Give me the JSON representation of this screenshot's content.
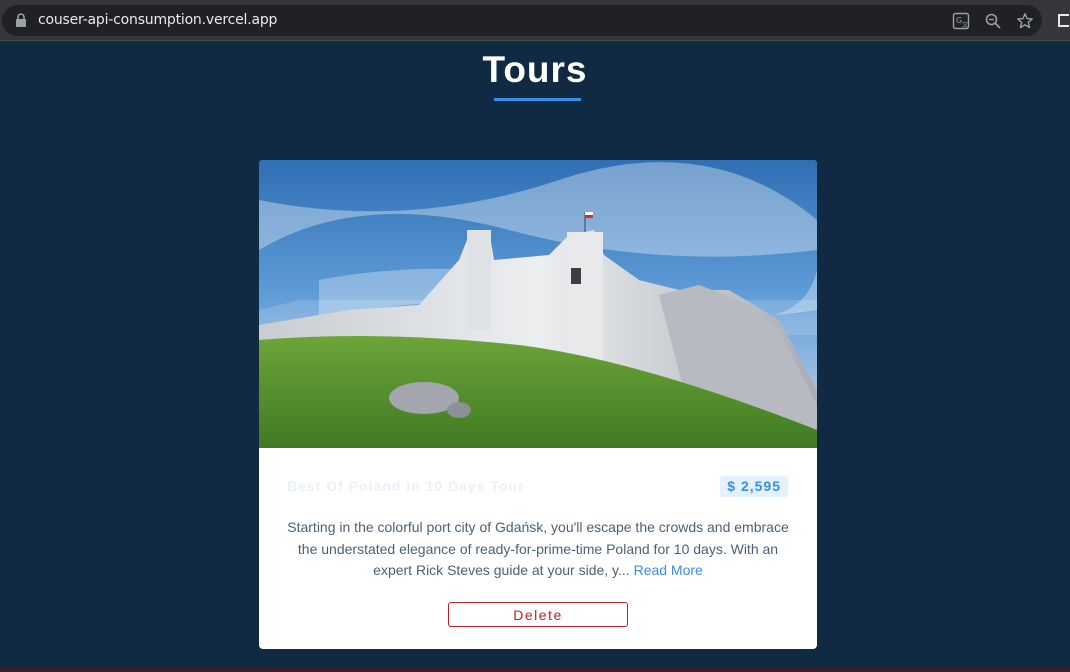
{
  "browser": {
    "url": "couser-api-consumption.vercel.app"
  },
  "page": {
    "title": "Tours"
  },
  "tour": {
    "name": "Best Of Poland In 10 Days Tour",
    "price": "$ 2,595",
    "info": "Starting in the colorful port city of Gdańsk, you'll escape the crowds and embrace the understated elegance of ready-for-prime-time Poland for 10 days. With an expert Rick Steves guide at your side, y...",
    "read_more_label": "Read More",
    "delete_label": "Delete"
  },
  "colors": {
    "background": "#102a43",
    "accent": "#3b8ee8",
    "danger": "#b5252a"
  }
}
